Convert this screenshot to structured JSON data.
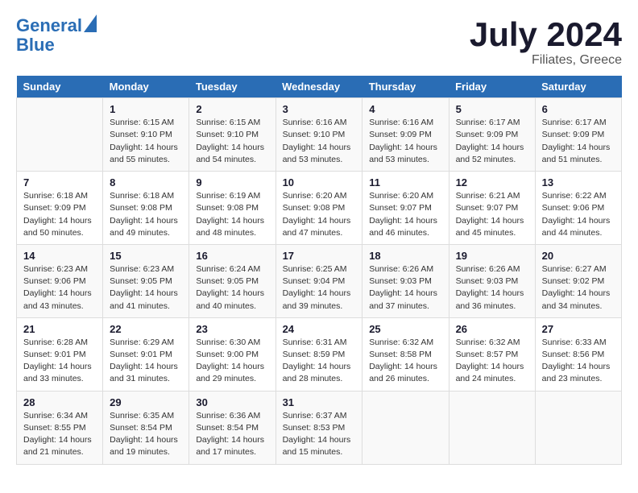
{
  "header": {
    "logo_line1": "General",
    "logo_line2": "Blue",
    "month": "July 2024",
    "location": "Filiates, Greece"
  },
  "columns": [
    "Sunday",
    "Monday",
    "Tuesday",
    "Wednesday",
    "Thursday",
    "Friday",
    "Saturday"
  ],
  "weeks": [
    [
      {
        "day": "",
        "info": ""
      },
      {
        "day": "1",
        "info": "Sunrise: 6:15 AM\nSunset: 9:10 PM\nDaylight: 14 hours\nand 55 minutes."
      },
      {
        "day": "2",
        "info": "Sunrise: 6:15 AM\nSunset: 9:10 PM\nDaylight: 14 hours\nand 54 minutes."
      },
      {
        "day": "3",
        "info": "Sunrise: 6:16 AM\nSunset: 9:10 PM\nDaylight: 14 hours\nand 53 minutes."
      },
      {
        "day": "4",
        "info": "Sunrise: 6:16 AM\nSunset: 9:09 PM\nDaylight: 14 hours\nand 53 minutes."
      },
      {
        "day": "5",
        "info": "Sunrise: 6:17 AM\nSunset: 9:09 PM\nDaylight: 14 hours\nand 52 minutes."
      },
      {
        "day": "6",
        "info": "Sunrise: 6:17 AM\nSunset: 9:09 PM\nDaylight: 14 hours\nand 51 minutes."
      }
    ],
    [
      {
        "day": "7",
        "info": "Sunrise: 6:18 AM\nSunset: 9:09 PM\nDaylight: 14 hours\nand 50 minutes."
      },
      {
        "day": "8",
        "info": "Sunrise: 6:18 AM\nSunset: 9:08 PM\nDaylight: 14 hours\nand 49 minutes."
      },
      {
        "day": "9",
        "info": "Sunrise: 6:19 AM\nSunset: 9:08 PM\nDaylight: 14 hours\nand 48 minutes."
      },
      {
        "day": "10",
        "info": "Sunrise: 6:20 AM\nSunset: 9:08 PM\nDaylight: 14 hours\nand 47 minutes."
      },
      {
        "day": "11",
        "info": "Sunrise: 6:20 AM\nSunset: 9:07 PM\nDaylight: 14 hours\nand 46 minutes."
      },
      {
        "day": "12",
        "info": "Sunrise: 6:21 AM\nSunset: 9:07 PM\nDaylight: 14 hours\nand 45 minutes."
      },
      {
        "day": "13",
        "info": "Sunrise: 6:22 AM\nSunset: 9:06 PM\nDaylight: 14 hours\nand 44 minutes."
      }
    ],
    [
      {
        "day": "14",
        "info": "Sunrise: 6:23 AM\nSunset: 9:06 PM\nDaylight: 14 hours\nand 43 minutes."
      },
      {
        "day": "15",
        "info": "Sunrise: 6:23 AM\nSunset: 9:05 PM\nDaylight: 14 hours\nand 41 minutes."
      },
      {
        "day": "16",
        "info": "Sunrise: 6:24 AM\nSunset: 9:05 PM\nDaylight: 14 hours\nand 40 minutes."
      },
      {
        "day": "17",
        "info": "Sunrise: 6:25 AM\nSunset: 9:04 PM\nDaylight: 14 hours\nand 39 minutes."
      },
      {
        "day": "18",
        "info": "Sunrise: 6:26 AM\nSunset: 9:03 PM\nDaylight: 14 hours\nand 37 minutes."
      },
      {
        "day": "19",
        "info": "Sunrise: 6:26 AM\nSunset: 9:03 PM\nDaylight: 14 hours\nand 36 minutes."
      },
      {
        "day": "20",
        "info": "Sunrise: 6:27 AM\nSunset: 9:02 PM\nDaylight: 14 hours\nand 34 minutes."
      }
    ],
    [
      {
        "day": "21",
        "info": "Sunrise: 6:28 AM\nSunset: 9:01 PM\nDaylight: 14 hours\nand 33 minutes."
      },
      {
        "day": "22",
        "info": "Sunrise: 6:29 AM\nSunset: 9:01 PM\nDaylight: 14 hours\nand 31 minutes."
      },
      {
        "day": "23",
        "info": "Sunrise: 6:30 AM\nSunset: 9:00 PM\nDaylight: 14 hours\nand 29 minutes."
      },
      {
        "day": "24",
        "info": "Sunrise: 6:31 AM\nSunset: 8:59 PM\nDaylight: 14 hours\nand 28 minutes."
      },
      {
        "day": "25",
        "info": "Sunrise: 6:32 AM\nSunset: 8:58 PM\nDaylight: 14 hours\nand 26 minutes."
      },
      {
        "day": "26",
        "info": "Sunrise: 6:32 AM\nSunset: 8:57 PM\nDaylight: 14 hours\nand 24 minutes."
      },
      {
        "day": "27",
        "info": "Sunrise: 6:33 AM\nSunset: 8:56 PM\nDaylight: 14 hours\nand 23 minutes."
      }
    ],
    [
      {
        "day": "28",
        "info": "Sunrise: 6:34 AM\nSunset: 8:55 PM\nDaylight: 14 hours\nand 21 minutes."
      },
      {
        "day": "29",
        "info": "Sunrise: 6:35 AM\nSunset: 8:54 PM\nDaylight: 14 hours\nand 19 minutes."
      },
      {
        "day": "30",
        "info": "Sunrise: 6:36 AM\nSunset: 8:54 PM\nDaylight: 14 hours\nand 17 minutes."
      },
      {
        "day": "31",
        "info": "Sunrise: 6:37 AM\nSunset: 8:53 PM\nDaylight: 14 hours\nand 15 minutes."
      },
      {
        "day": "",
        "info": ""
      },
      {
        "day": "",
        "info": ""
      },
      {
        "day": "",
        "info": ""
      }
    ]
  ]
}
